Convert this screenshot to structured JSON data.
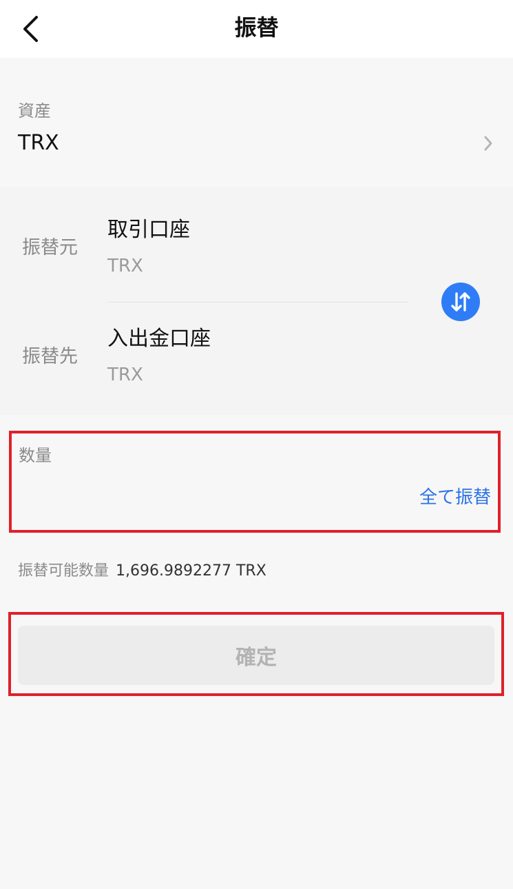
{
  "header": {
    "title": "振替"
  },
  "asset": {
    "label": "資産",
    "value": "TRX"
  },
  "transfer": {
    "from_label": "振替元",
    "from_account": "取引口座",
    "from_currency": "TRX",
    "to_label": "振替先",
    "to_account": "入出金口座",
    "to_currency": "TRX"
  },
  "quantity": {
    "label": "数量",
    "value": "",
    "placeholder": "",
    "transfer_all_label": "全て振替"
  },
  "available": {
    "label": "振替可能数量",
    "value": "1,696.9892277 TRX"
  },
  "confirm": {
    "label": "確定"
  },
  "colors": {
    "accent_blue": "#2f7df6",
    "link_blue": "#2b73e6",
    "highlight_red": "#e0202a"
  }
}
